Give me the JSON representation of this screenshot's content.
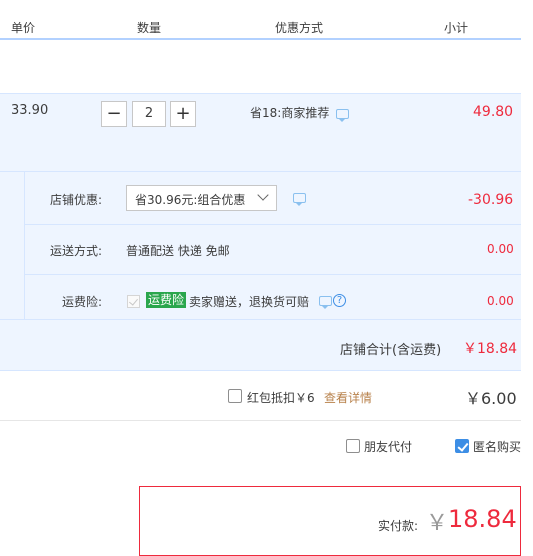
{
  "header": {
    "col_price": "单价",
    "col_qty": "数量",
    "col_promo": "优惠方式",
    "col_subtotal": "小计"
  },
  "item": {
    "price": "33.90",
    "qty_minus": "−",
    "qty_value": "2",
    "qty_plus": "+",
    "promo": "省18:商家推荐",
    "subtotal": "49.80"
  },
  "store": {
    "discount_label": "店铺优惠:",
    "discount_select": "省30.96元:组合优惠",
    "discount_value": "-30.96",
    "shipping_label": "运送方式:",
    "shipping_text": "普通配送 快递 免邮",
    "shipping_value": "0.00",
    "insurance_label": "运费险:",
    "insurance_badge": "运费险",
    "insurance_text": "卖家赠送，退换货可赔",
    "insurance_value": "0.00",
    "total_label": "店铺合计(含运费)",
    "total_value": "￥18.84"
  },
  "red_packet": {
    "label": "红包抵扣￥6",
    "link": "查看详情",
    "amount": "￥6.00"
  },
  "options": {
    "friend_pay": "朋友代付",
    "anonymous": "匿名购买",
    "anonymous_checked": true
  },
  "pay": {
    "label": "实付款:",
    "currency": "￥",
    "amount": "18.84"
  },
  "colors": {
    "accent_red": "#ee2a3d",
    "row_bg": "#eef5ff",
    "header_border": "#b2d1ff",
    "link_brown": "#b8824c",
    "badge_green": "#2aa64d"
  }
}
